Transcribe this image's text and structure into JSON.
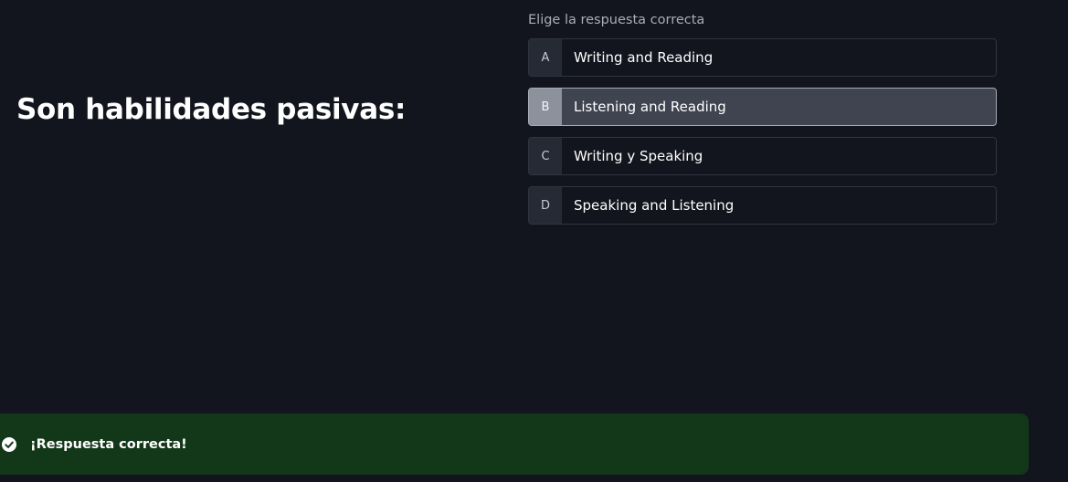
{
  "question": {
    "text": "Son habilidades pasivas:"
  },
  "instruction": "Elige la respuesta correcta",
  "options": [
    {
      "letter": "A",
      "label": "Writing and Reading",
      "selected": false
    },
    {
      "letter": "B",
      "label": "Listening and Reading",
      "selected": true
    },
    {
      "letter": "C",
      "label": "Writing y Speaking",
      "selected": false
    },
    {
      "letter": "D",
      "label": "Speaking and Listening",
      "selected": false
    }
  ],
  "feedback": {
    "message": "¡Respuesta correcta!",
    "icon": "check-circle-icon",
    "color": "#133819"
  },
  "colors": {
    "background": "#13151e",
    "option_border": "#30343e",
    "selected_background": "#3f4450",
    "success": "#133819"
  }
}
